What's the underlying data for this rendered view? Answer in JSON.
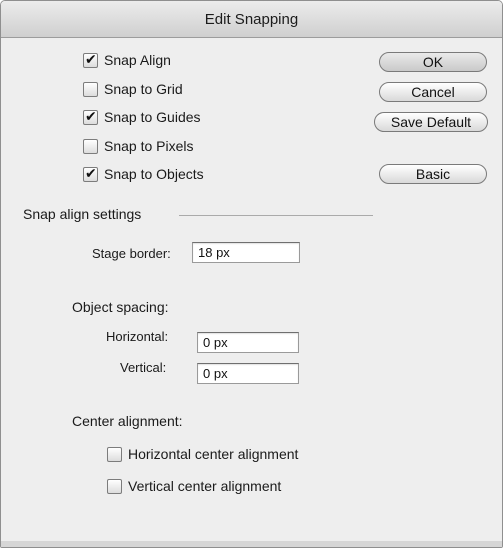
{
  "window": {
    "title": "Edit Snapping"
  },
  "snap_options": [
    {
      "label": "Snap Align",
      "checked": true
    },
    {
      "label": "Snap to Grid",
      "checked": false
    },
    {
      "label": "Snap to Guides",
      "checked": true
    },
    {
      "label": "Snap to Pixels",
      "checked": false
    },
    {
      "label": "Snap to Objects",
      "checked": true
    }
  ],
  "buttons": {
    "ok": "OK",
    "cancel": "Cancel",
    "save_default": "Save Default",
    "basic": "Basic"
  },
  "snap_align_settings": {
    "title": "Snap align settings",
    "stage_border_label": "Stage border:",
    "stage_border_value": "18 px",
    "object_spacing_title": "Object spacing:",
    "horizontal_label": "Horizontal:",
    "horizontal_value": "0 px",
    "vertical_label": "Vertical:",
    "vertical_value": "0 px",
    "center_alignment_title": "Center alignment:",
    "center_options": [
      {
        "label": "Horizontal center alignment",
        "checked": false
      },
      {
        "label": "Vertical center alignment",
        "checked": false
      }
    ]
  },
  "check_glyph": "✔"
}
